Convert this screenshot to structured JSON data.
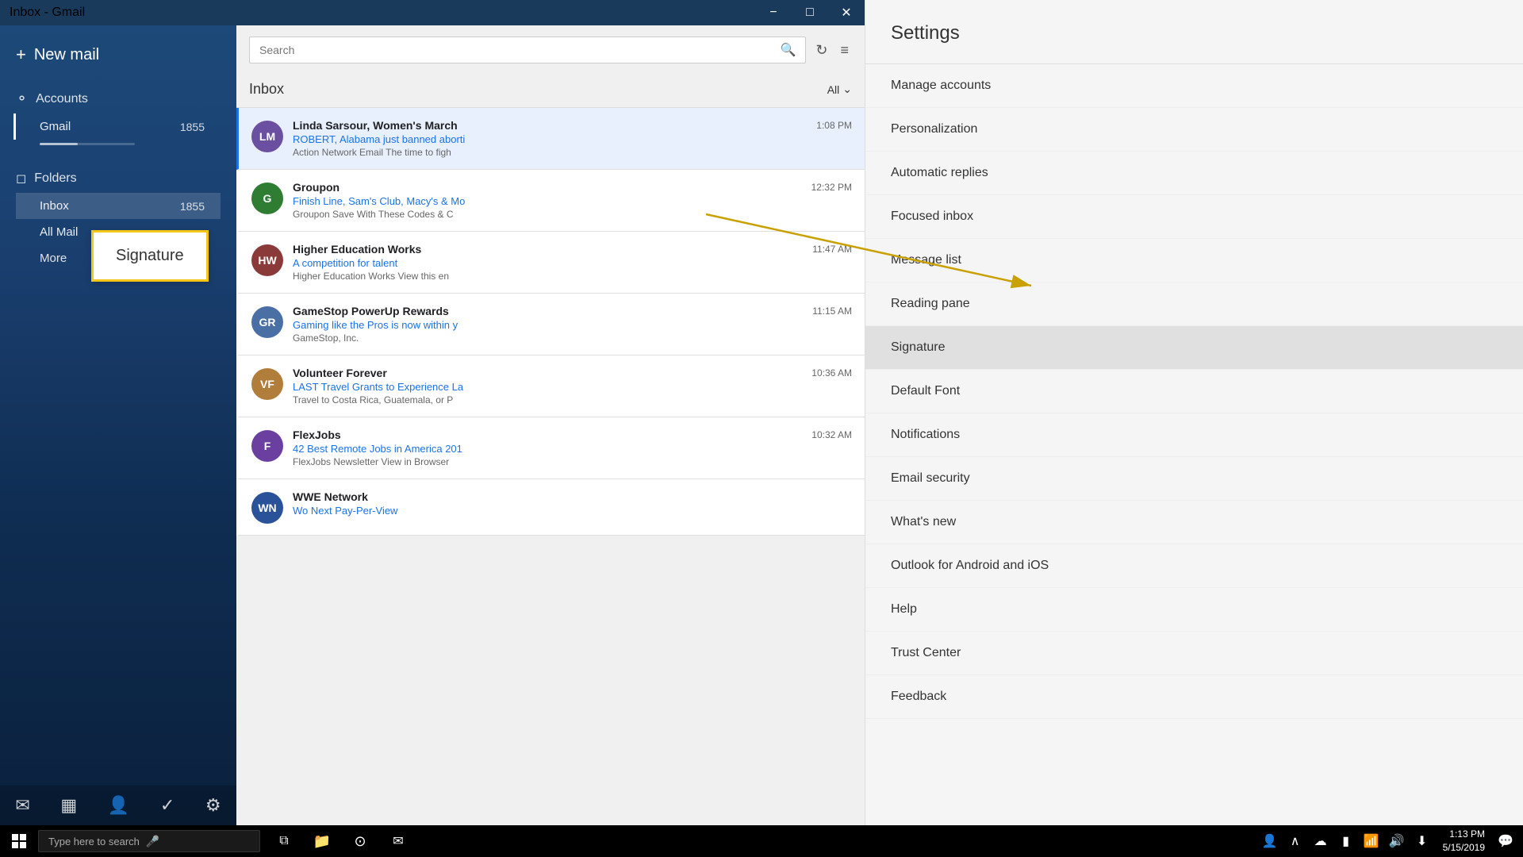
{
  "titleBar": {
    "title": "Inbox - Gmail",
    "controls": [
      "minimize",
      "maximize",
      "close"
    ]
  },
  "sidebar": {
    "hamburgerLabel": "☰",
    "appTitle": "Inbox - Gmail",
    "newMail": "New mail",
    "accounts": "Accounts",
    "gmail": "Gmail",
    "gmailCount": "1855",
    "folders": "Folders",
    "inbox": "Inbox",
    "inboxCount": "1855",
    "allMail": "All Mail",
    "more": "More",
    "bottomIcons": [
      "mail",
      "calendar",
      "people",
      "tasks",
      "settings"
    ]
  },
  "search": {
    "placeholder": "Search"
  },
  "inbox": {
    "title": "Inbox",
    "filter": "All"
  },
  "emails": [
    {
      "initials": "LM",
      "color": "#6b4fa0",
      "sender": "Linda Sarsour, Women's March",
      "subject": "ROBERT, Alabama just banned aborti",
      "preview": "Action Network Email The time to figh",
      "time": "1:08 PM",
      "selected": true
    },
    {
      "initials": "G",
      "color": "#2e7d32",
      "sender": "Groupon",
      "subject": "Finish Line, Sam's Club, Macy's & Mo",
      "preview": "Groupon Save With These Codes & C",
      "time": "12:32 PM",
      "selected": false
    },
    {
      "initials": "HW",
      "color": "#8b3a3a",
      "sender": "Higher Education Works",
      "subject": "A competition for talent",
      "preview": "Higher Education Works View this en",
      "time": "11:47 AM",
      "selected": false
    },
    {
      "initials": "GR",
      "color": "#4a6fa5",
      "sender": "GameStop PowerUp Rewards",
      "subject": "Gaming like the Pros is now within y",
      "preview": "GameStop, Inc.",
      "time": "11:15 AM",
      "selected": false
    },
    {
      "initials": "VF",
      "color": "#b07d3a",
      "sender": "Volunteer Forever",
      "subject": "LAST Travel Grants to Experience La",
      "preview": "Travel to Costa Rica, Guatemala, or P",
      "time": "10:36 AM",
      "selected": false
    },
    {
      "initials": "F",
      "color": "#6a3fa0",
      "sender": "FlexJobs",
      "subject": "42 Best Remote Jobs in America 201",
      "preview": "FlexJobs Newsletter View in Browser",
      "time": "10:32 AM",
      "selected": false
    },
    {
      "initials": "WN",
      "color": "#2a5298",
      "sender": "WWE Network",
      "subject": "Wo Next Pay-Per-View",
      "preview": "",
      "time": "",
      "selected": false
    }
  ],
  "settings": {
    "title": "Settings",
    "items": [
      "Manage accounts",
      "Personalization",
      "Automatic replies",
      "Focused inbox",
      "Message list",
      "Reading pane",
      "Signature",
      "Default Font",
      "Notifications",
      "Email security",
      "What's new",
      "Outlook for Android and iOS",
      "Help",
      "Trust Center",
      "Feedback"
    ],
    "activeItem": "Signature"
  },
  "signatureTooltip": "Signature",
  "taskbar": {
    "searchPlaceholder": "Type here to search",
    "clock": "1:13 PM\n5/15/2019"
  }
}
